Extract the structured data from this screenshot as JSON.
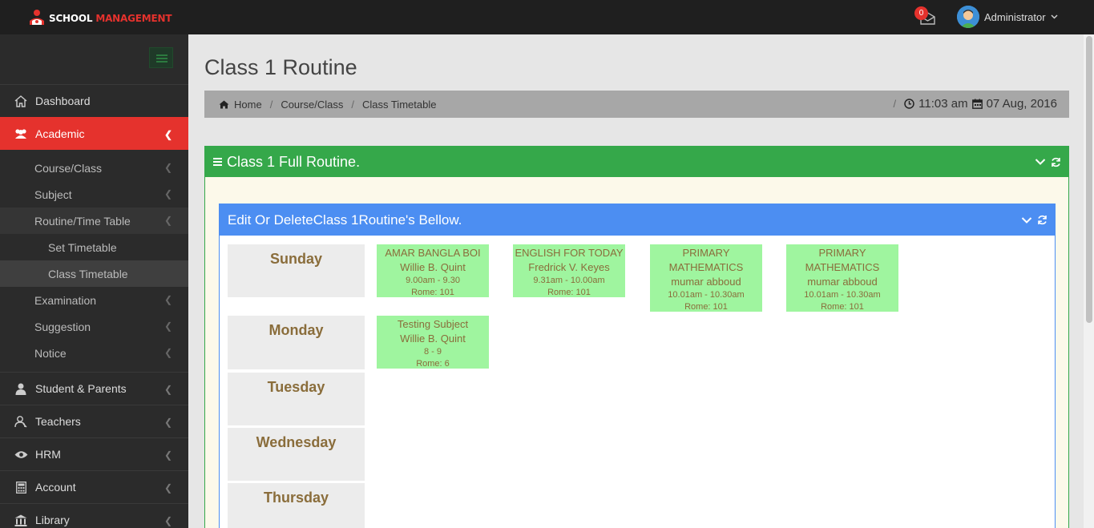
{
  "brand": {
    "part1": "SCHOOL ",
    "part2": "MANAGEMENT"
  },
  "topbar": {
    "notification_count": "0",
    "user_name": "Administrator"
  },
  "sidebar": {
    "items": [
      {
        "label": "Dashboard",
        "icon": "home-icon"
      },
      {
        "label": "Academic",
        "icon": "users-icon",
        "active": true
      },
      {
        "label": "Student & Parents",
        "icon": "user-icon"
      },
      {
        "label": "Teachers",
        "icon": "teacher-icon"
      },
      {
        "label": "HRM",
        "icon": "eye-icon"
      },
      {
        "label": "Account",
        "icon": "calculator-icon"
      },
      {
        "label": "Library",
        "icon": "bank-icon"
      }
    ],
    "academic_sub": [
      {
        "label": "Course/Class"
      },
      {
        "label": "Subject"
      },
      {
        "label": "Routine/Time Table"
      },
      {
        "label": "Examination"
      },
      {
        "label": "Suggestion"
      },
      {
        "label": "Notice"
      }
    ],
    "routine_sub": [
      {
        "label": "Set Timetable"
      },
      {
        "label": "Class Timetable"
      }
    ]
  },
  "page": {
    "title": "Class 1 Routine",
    "breadcrumb": [
      "Home",
      "Course/Class",
      "Class Timetable"
    ],
    "time": "11:03 am",
    "date": "07 Aug, 2016"
  },
  "panel": {
    "title": "Class 1 Full Routine."
  },
  "inner_panel": {
    "title": "Edit Or DeleteClass 1Routine's Bellow."
  },
  "routine": {
    "days": [
      "Sunday",
      "Monday",
      "Tuesday",
      "Wednesday",
      "Thursday"
    ],
    "sunday": [
      {
        "subject": "AMAR BANGLA BOI",
        "teacher": "Willie B. Quint",
        "time": "9.00am - 9.30",
        "room": "Rome: 101"
      },
      {
        "subject": "ENGLISH FOR TODAY",
        "teacher": "Fredrick V. Keyes",
        "time": "9.31am - 10.00am",
        "room": "Rome: 101"
      },
      {
        "subject": "PRIMARY MATHEMATICS",
        "teacher": "mumar abboud",
        "time": "10.01am - 10.30am",
        "room": "Rome: 101"
      },
      {
        "subject": "PRIMARY MATHEMATICS",
        "teacher": "mumar abboud",
        "time": "10.01am - 10.30am",
        "room": "Rome: 101"
      }
    ],
    "monday": [
      {
        "subject": "Testing Subject",
        "teacher": "Willie B. Quint",
        "time": "8 - 9",
        "room": "Rome: 6"
      }
    ]
  },
  "colors": {
    "accent_red": "#e5322d",
    "panel_green": "#35a84a",
    "panel_blue": "#4c8ef2",
    "slot_green": "#9ff59f"
  }
}
